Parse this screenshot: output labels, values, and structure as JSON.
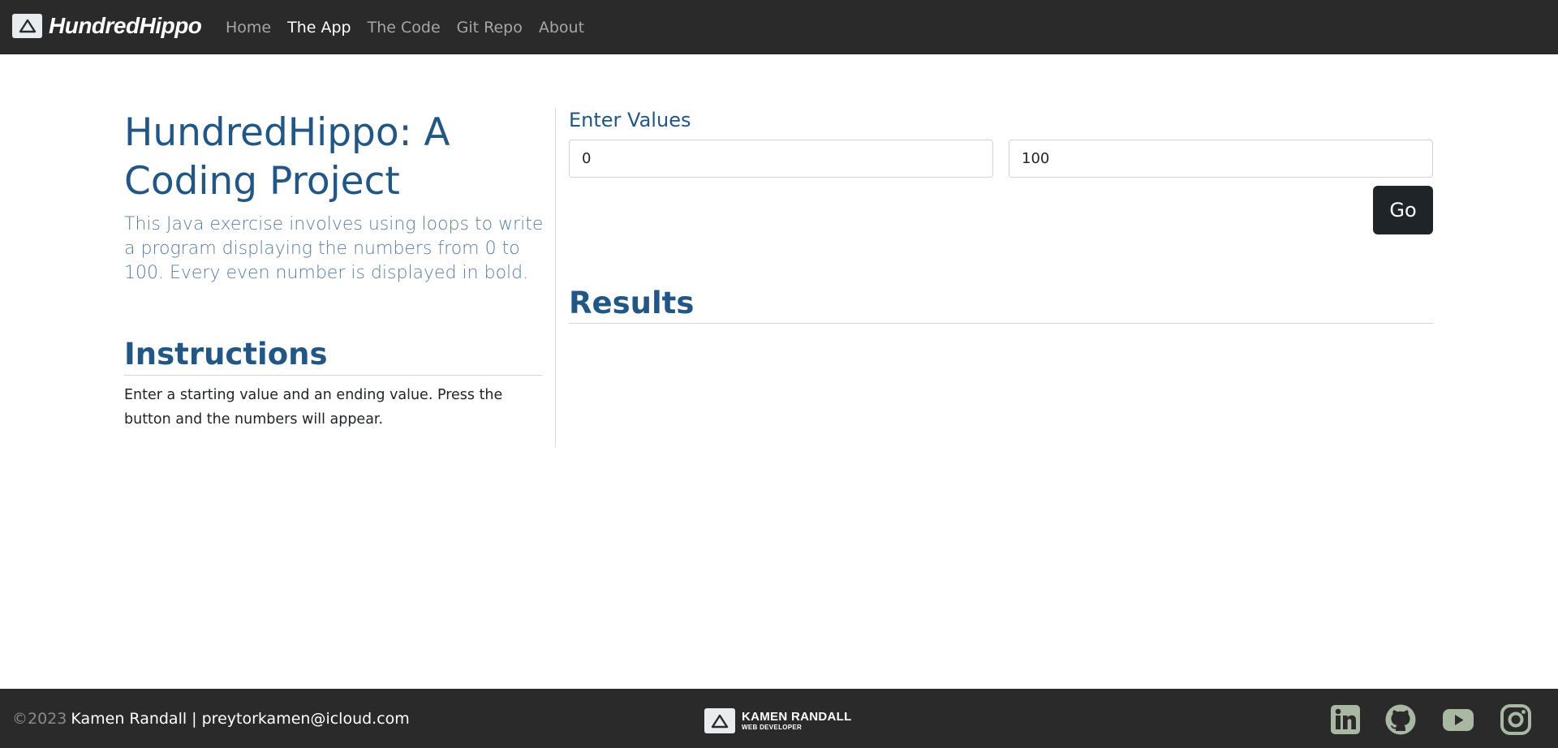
{
  "nav": {
    "brand": "HundredHippo",
    "links": [
      {
        "label": "Home"
      },
      {
        "label": "The App"
      },
      {
        "label": "The Code"
      },
      {
        "label": "Git Repo"
      },
      {
        "label": "About"
      }
    ]
  },
  "intro": {
    "title": "HundredHippo: A Coding Project",
    "lead": "This Java exercise involves using loops to write a program displaying the numbers from 0 to 100. Every even number is displayed in bold."
  },
  "instructions": {
    "heading": "Instructions",
    "text": "Enter a starting value and an ending value. Press the button and the numbers will appear."
  },
  "form": {
    "label": "Enter Values",
    "start_value": "0",
    "end_value": "100",
    "go_label": "Go"
  },
  "results": {
    "heading": "Results"
  },
  "footer": {
    "year": "©2023",
    "contact": "Kamen Randall | preytorkamen@icloud.com",
    "logo_name": "KAMEN RANDALL",
    "logo_sub": "WEB DEVELOPER",
    "social_icons": [
      "linkedin-icon",
      "github-icon",
      "youtube-icon",
      "instagram-icon"
    ],
    "icon_color": "#a9b8a3"
  },
  "colors": {
    "navbar_bg": "#2a2a2a",
    "heading_blue": "#225685",
    "lead_blue": "#5b7da0",
    "button_dark": "#1f2429"
  }
}
